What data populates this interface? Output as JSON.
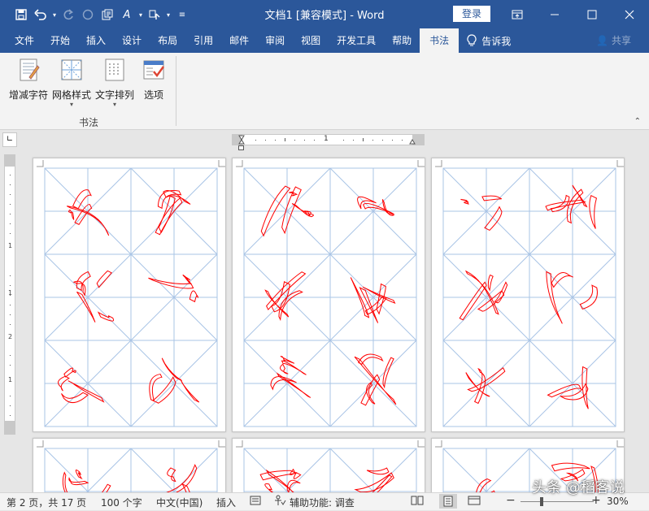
{
  "titlebar": {
    "doc_title": "文档1 [兼容模式] - Word",
    "login": "登录",
    "qat_icons": [
      "save-icon",
      "undo-icon",
      "redo-icon",
      "circle-icon",
      "layout-icon",
      "text-effects-icon",
      "touch-mode-icon",
      "customize-icon"
    ],
    "window_controls": [
      "ribbon-display-icon",
      "minimize-icon",
      "maximize-icon",
      "close-icon"
    ]
  },
  "tabs": {
    "items": [
      "文件",
      "开始",
      "插入",
      "设计",
      "布局",
      "引用",
      "邮件",
      "审阅",
      "视图",
      "开发工具",
      "帮助",
      "书法"
    ],
    "active": "书法",
    "tell_me": "告诉我",
    "share": "共享"
  },
  "ribbon": {
    "buttons": [
      {
        "label": "增减字符",
        "icon": "add-remove-chars-icon",
        "has_dropdown": false
      },
      {
        "label": "网格样式",
        "icon": "grid-style-icon",
        "has_dropdown": true
      },
      {
        "label": "文字排列",
        "icon": "text-arrange-icon",
        "has_dropdown": true
      },
      {
        "label": "选项",
        "icon": "options-icon",
        "has_dropdown": false
      }
    ],
    "group_label": "书法"
  },
  "ruler": {
    "h_number": "1",
    "v_numbers": [
      "1",
      "1",
      "2",
      "1"
    ]
  },
  "grid": {
    "line_color": "#a9c4e6",
    "char_color": "#ff0000"
  },
  "status": {
    "page": "第 2 页，共 17 页",
    "words": "100 个字",
    "language": "中文(中国)",
    "mode": "插入",
    "accessibility": "辅助功能: 调查",
    "zoom": "30%"
  },
  "watermark": "头条 @稻客说"
}
